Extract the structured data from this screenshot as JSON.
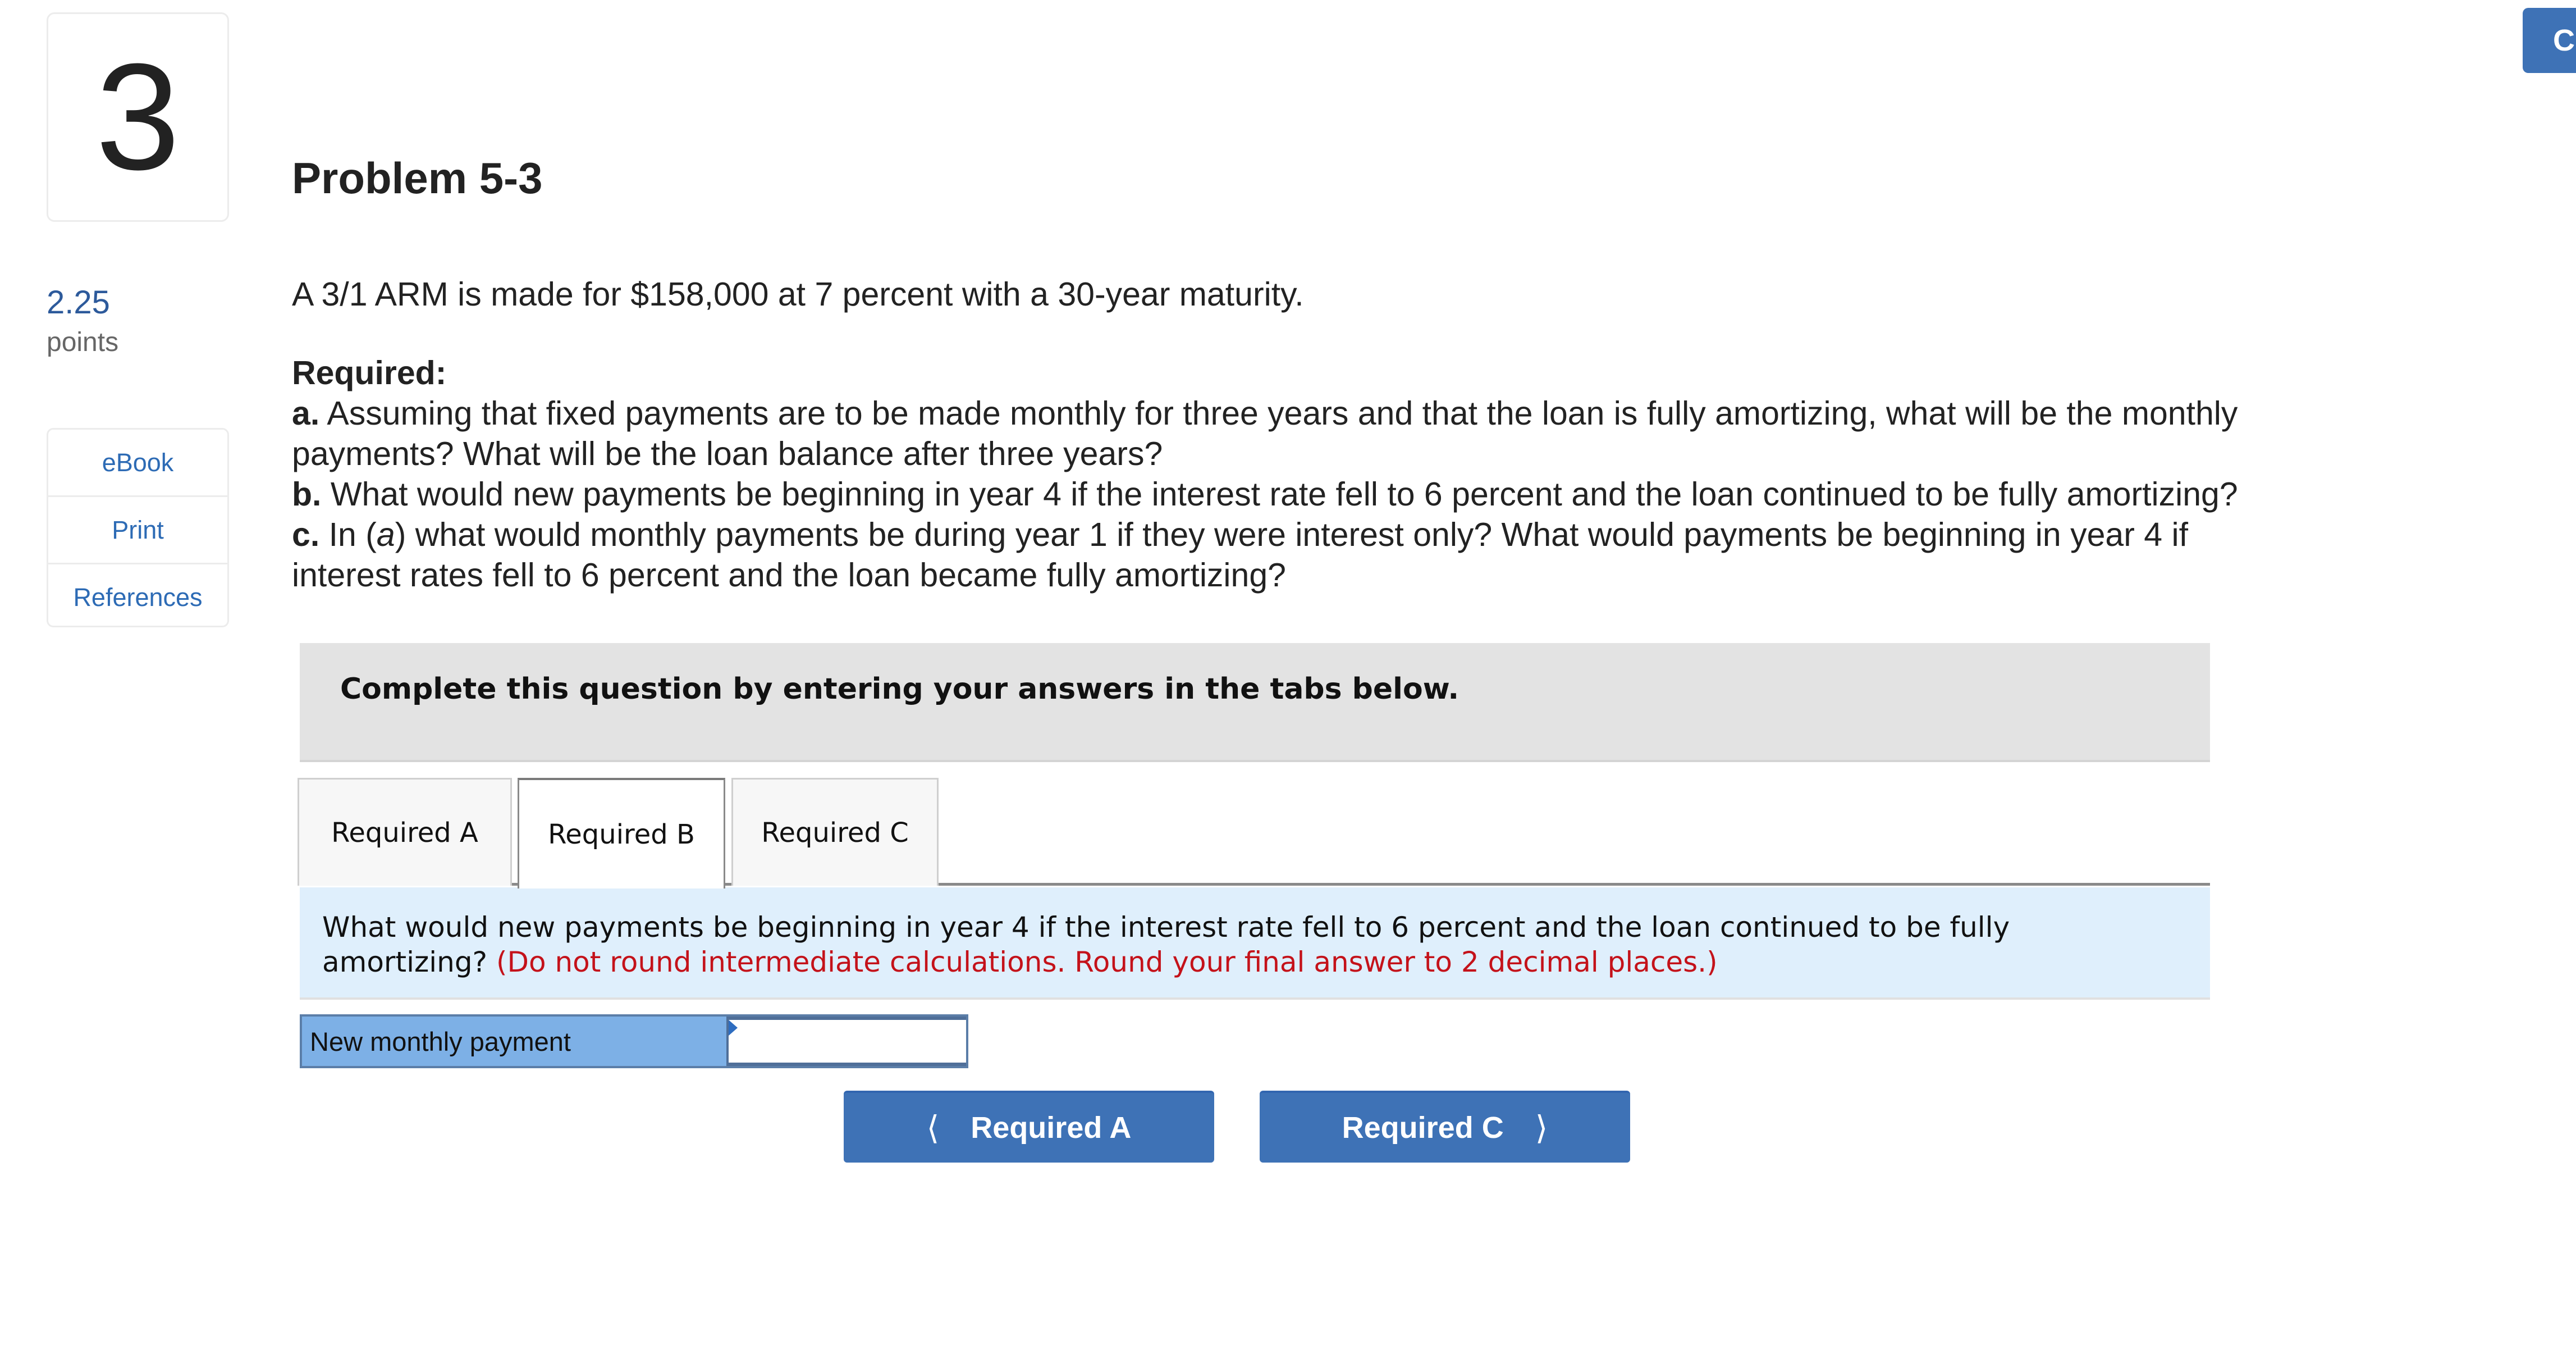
{
  "question": {
    "number": "3",
    "points_value": "2.25",
    "points_label": "points"
  },
  "tools": [
    {
      "label": "eBook"
    },
    {
      "label": "Print"
    },
    {
      "label": "References"
    }
  ],
  "corner_button": {
    "label": "C"
  },
  "problem": {
    "title": "Problem 5-3",
    "intro": "A 3/1 ARM is made for $158,000 at 7 percent with a 30-year maturity.",
    "required_heading": "Required:",
    "parts": [
      {
        "prefix": "a.",
        "lines": [
          " Assuming that fixed payments are to be made monthly for three years and that the loan is fully amortizing, what will be the monthly",
          "payments? What will be the loan balance after three years?"
        ]
      },
      {
        "prefix": "b.",
        "lines": [
          " What would new payments be beginning in year 4 if the interest rate fell to 6 percent and the loan continued to be fully amortizing?"
        ]
      },
      {
        "prefix": "c.",
        "pre_italic": " In (",
        "italic": "a",
        "post_italic": ") what would monthly payments be during year 1 if they were interest only? What would payments be beginning in year 4 if",
        "lines": [
          "interest rates fell to 6 percent and the loan became fully amortizing?"
        ]
      }
    ]
  },
  "instructions": "Complete this question by entering your answers in the tabs below.",
  "tabs": [
    {
      "label": "Required A",
      "active": false
    },
    {
      "label": "Required B",
      "active": true
    },
    {
      "label": "Required C",
      "active": false
    }
  ],
  "active_question": {
    "text": "What would new payments be beginning in year 4 if the interest rate fell to 6 percent and the loan continued to be fully amortizing? ",
    "hint": "(Do not round intermediate calculations. Round your final answer to 2 decimal places.)"
  },
  "answer": {
    "label": "New monthly payment",
    "value": "",
    "placeholder": ""
  },
  "navigation": {
    "prev_label": "Required A",
    "next_label": "Required C",
    "prev_icon": "chevron-left-icon",
    "next_icon": "chevron-right-icon"
  },
  "colors": {
    "primary_button": "#3e72b6",
    "link": "#2d6bb5",
    "points": "#2d5a9b",
    "hint_red": "#c4121a",
    "question_bg": "#dfeffc",
    "instructions_bg": "#e3e3e3",
    "answer_label_bg": "#7db0e6"
  }
}
